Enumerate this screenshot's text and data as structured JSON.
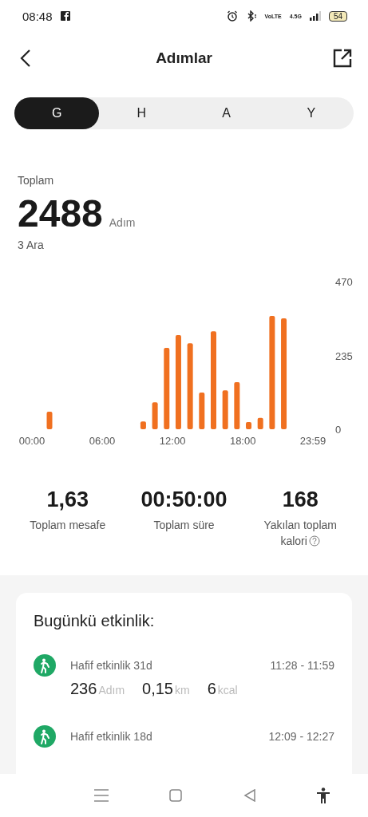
{
  "status_bar": {
    "time": "08:48",
    "volte": "VoLTE",
    "network": "4.5G",
    "battery": "54"
  },
  "header": {
    "title": "Adımlar"
  },
  "tabs": [
    {
      "label": "G",
      "selected": true
    },
    {
      "label": "H",
      "selected": false
    },
    {
      "label": "A",
      "selected": false
    },
    {
      "label": "Y",
      "selected": false
    }
  ],
  "total": {
    "label": "Toplam",
    "value": "2488",
    "unit": "Adım",
    "date": "3 Ara"
  },
  "chart_data": {
    "type": "bar",
    "x": [
      90,
      570,
      630,
      690,
      750,
      810,
      870,
      930,
      990,
      1050,
      1110,
      1170,
      1230,
      1290
    ],
    "series": [
      {
        "color": "#f07020",
        "values": [
          56,
          25,
          86,
          259,
          300,
          274,
          117,
          312,
          124,
          150,
          23,
          36,
          361,
          353
        ]
      }
    ],
    "xlim": [
      0,
      1439
    ],
    "ylim": [
      0,
      470
    ],
    "xticks": [
      {
        "value": 0,
        "label": "00:00"
      },
      {
        "value": 360,
        "label": "06:00"
      },
      {
        "value": 720,
        "label": "12:00"
      },
      {
        "value": 1080,
        "label": "18:00"
      },
      {
        "value": 1439,
        "label": "23:59"
      }
    ],
    "yticks": [
      0,
      235,
      470
    ]
  },
  "stats": [
    {
      "value": "1,63",
      "label": "Toplam mesafe",
      "help": false
    },
    {
      "value": "00:50:00",
      "label": "Toplam süre",
      "help": false
    },
    {
      "value": "168",
      "label": "Yakılan toplam kalori",
      "help": true
    }
  ],
  "activity": {
    "title": "Bugünkü etkinlik:",
    "items": [
      {
        "name": "Hafif etkinlik 31d",
        "time": "11:28 - 11:59",
        "metrics": [
          {
            "value": "236",
            "unit": "Adım"
          },
          {
            "value": "0,15",
            "unit": "km"
          },
          {
            "value": "6",
            "unit": "kcal"
          }
        ]
      },
      {
        "name": "Hafif etkinlik 18d",
        "time": "12:09 - 12:27"
      }
    ]
  }
}
